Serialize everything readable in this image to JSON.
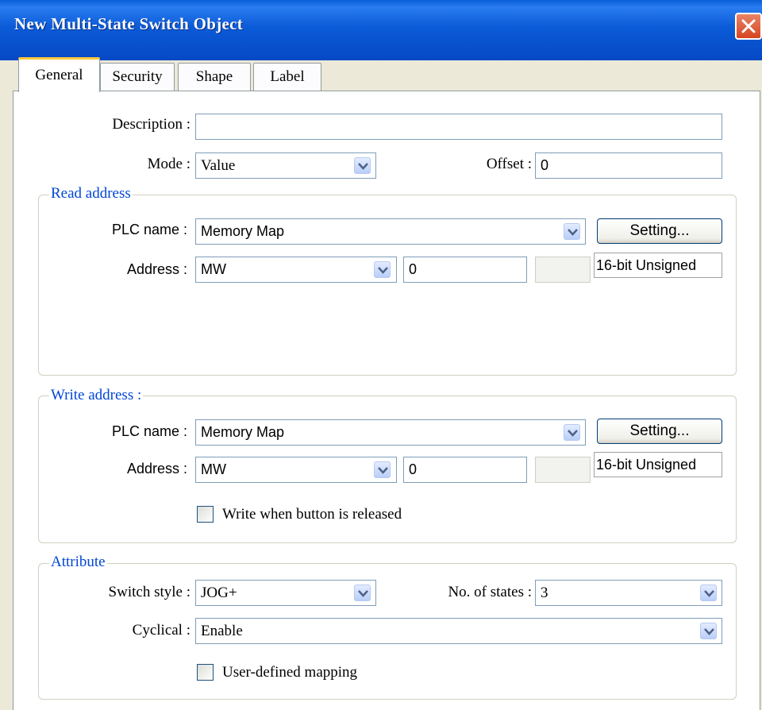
{
  "window": {
    "title": "New  Multi-State Switch Object"
  },
  "tabs": [
    {
      "label": "General",
      "active": true
    },
    {
      "label": "Security",
      "active": false
    },
    {
      "label": "Shape",
      "active": false
    },
    {
      "label": "Label",
      "active": false
    }
  ],
  "general": {
    "description_label": "Description :",
    "description_value": "",
    "mode_label": "Mode :",
    "mode_value": "Value",
    "offset_label": "Offset :",
    "offset_value": "0"
  },
  "read_address": {
    "title": "Read address",
    "plc_label": "PLC name :",
    "plc_value": "Memory Map",
    "setting_button": "Setting...",
    "address_label": "Address :",
    "address_device": "MW",
    "address_value": "0",
    "data_type": "16-bit Unsigned"
  },
  "write_address": {
    "title": "Write address :",
    "plc_label": "PLC name :",
    "plc_value": "Memory Map",
    "setting_button": "Setting...",
    "address_label": "Address :",
    "address_device": "MW",
    "address_value": "0",
    "data_type": "16-bit Unsigned",
    "write_on_release_label": "Write when button is released",
    "write_on_release_checked": false
  },
  "attribute": {
    "title": "Attribute",
    "switch_style_label": "Switch style :",
    "switch_style_value": "JOG+",
    "states_label": "No. of states :",
    "states_value": "3",
    "cyclical_label": "Cyclical :",
    "cyclical_value": "Enable",
    "user_mapping_label": "User-defined mapping",
    "user_mapping_checked": false
  },
  "colors": {
    "titlebar": "#0b5bd8",
    "group_title": "#0046d5",
    "close": "#d5451f",
    "active_tab_accent": "#ffc83c"
  }
}
